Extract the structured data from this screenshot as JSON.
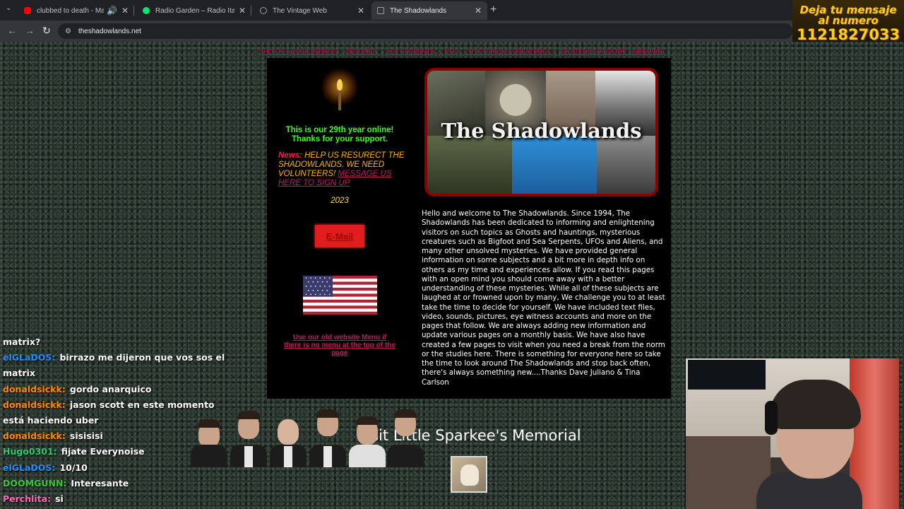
{
  "browser": {
    "tabs": [
      {
        "title": "clubbed to death - Matrix s",
        "active": false,
        "dot_color": "#ff0000"
      },
      {
        "title": "Radio Garden – Radio Ita Pora",
        "active": false,
        "dot_color": "#00e676"
      },
      {
        "title": "The Vintage Web",
        "active": false,
        "dot_color": "#9aa0a6"
      },
      {
        "title": "The Shadowlands",
        "active": true,
        "dot_color": "#9aa0a6"
      }
    ],
    "new_tab": "+",
    "back": "←",
    "forward": "→",
    "reload": "↻",
    "url": "theshadowlands.net"
  },
  "overlay_banner": {
    "line1": "Deja tu mensaje",
    "line2": "al numero",
    "line3": "1121827033"
  },
  "site": {
    "nav": [
      "GHOSTS and HAUNTINGS",
      "BIGFOOT",
      "SEA SERPENTS",
      "UFO",
      "MYSTERIOUS CREATURES",
      "MYSTERIES AND THE UNKNOWN"
    ],
    "welcome_line1": "This is our 29th year online!",
    "welcome_line2": "Thanks for your support.",
    "news_label": "News:",
    "news_text": " HELP US RESURECT THE SHADOWLANDS.  WE NEED VOLUNTEERS! ",
    "news_link": "MESSAGE US HERE TO SIGN UP",
    "year": "2023",
    "email_button": "E-Mail",
    "old_menu_link": "Use our old website Menu if there is no menu at the top of the page",
    "logo_title": "The Shadowlands",
    "intro": "Hello and welcome to The Shadowlands. Since 1994, The Shadowlands has been dedicated to informing and enlightening visitors on such topics as Ghosts and hauntings, mysterious creatures such as Bigfoot and Sea Serpents, UFOs and Aliens, and many other unsolved mysteries. We have provided general information on some subjects and a bit more in depth info on others as my time and experiences allow. If you read this pages with an open mind you should come away with a better understanding of these mysteries. While all of these subjects are laughed at or frowned upon by many, We challenge you to at least take the time to decide for yourself. We have included text files, video, sounds, pictures, eye witness accounts and more on the pages that follow. We are always adding new information and update various pages on a monthly basis. We have also have created a few pages to visit when you need a break from the norm or the studies here. There is something for everyone here so take the time to look around The Shadowlands and stop back often, there's always something new....Thanks Dave Juliano & Tina Carlson",
    "memorial_heading": "Visit Little Sparkee's Memorial"
  },
  "chat": [
    {
      "user": "",
      "color": "#ffffff",
      "text": "matrix?"
    },
    {
      "user": "elGLaDOS:",
      "color": "#1e90ff",
      "text": "birrazo me dijeron que vos sos el matrix"
    },
    {
      "user": "donaldsickk:",
      "color": "#ff8c00",
      "text": "gordo anarquico"
    },
    {
      "user": "donaldsickk:",
      "color": "#ff8c00",
      "text": "jason scott en este momento está haciendo uber"
    },
    {
      "user": "donaldsickk:",
      "color": "#ff8c00",
      "text": "sisisisi"
    },
    {
      "user": "Hugo0301:",
      "color": "#2ecc71",
      "text": "fijate Everynoise"
    },
    {
      "user": "elGLaDOS:",
      "color": "#1e90ff",
      "text": "10/10"
    },
    {
      "user": "DOOMGUNN:",
      "color": "#32cd32",
      "text": "Interesante"
    },
    {
      "user": "Perchlita:",
      "color": "#ff69b4",
      "text": "si"
    }
  ]
}
